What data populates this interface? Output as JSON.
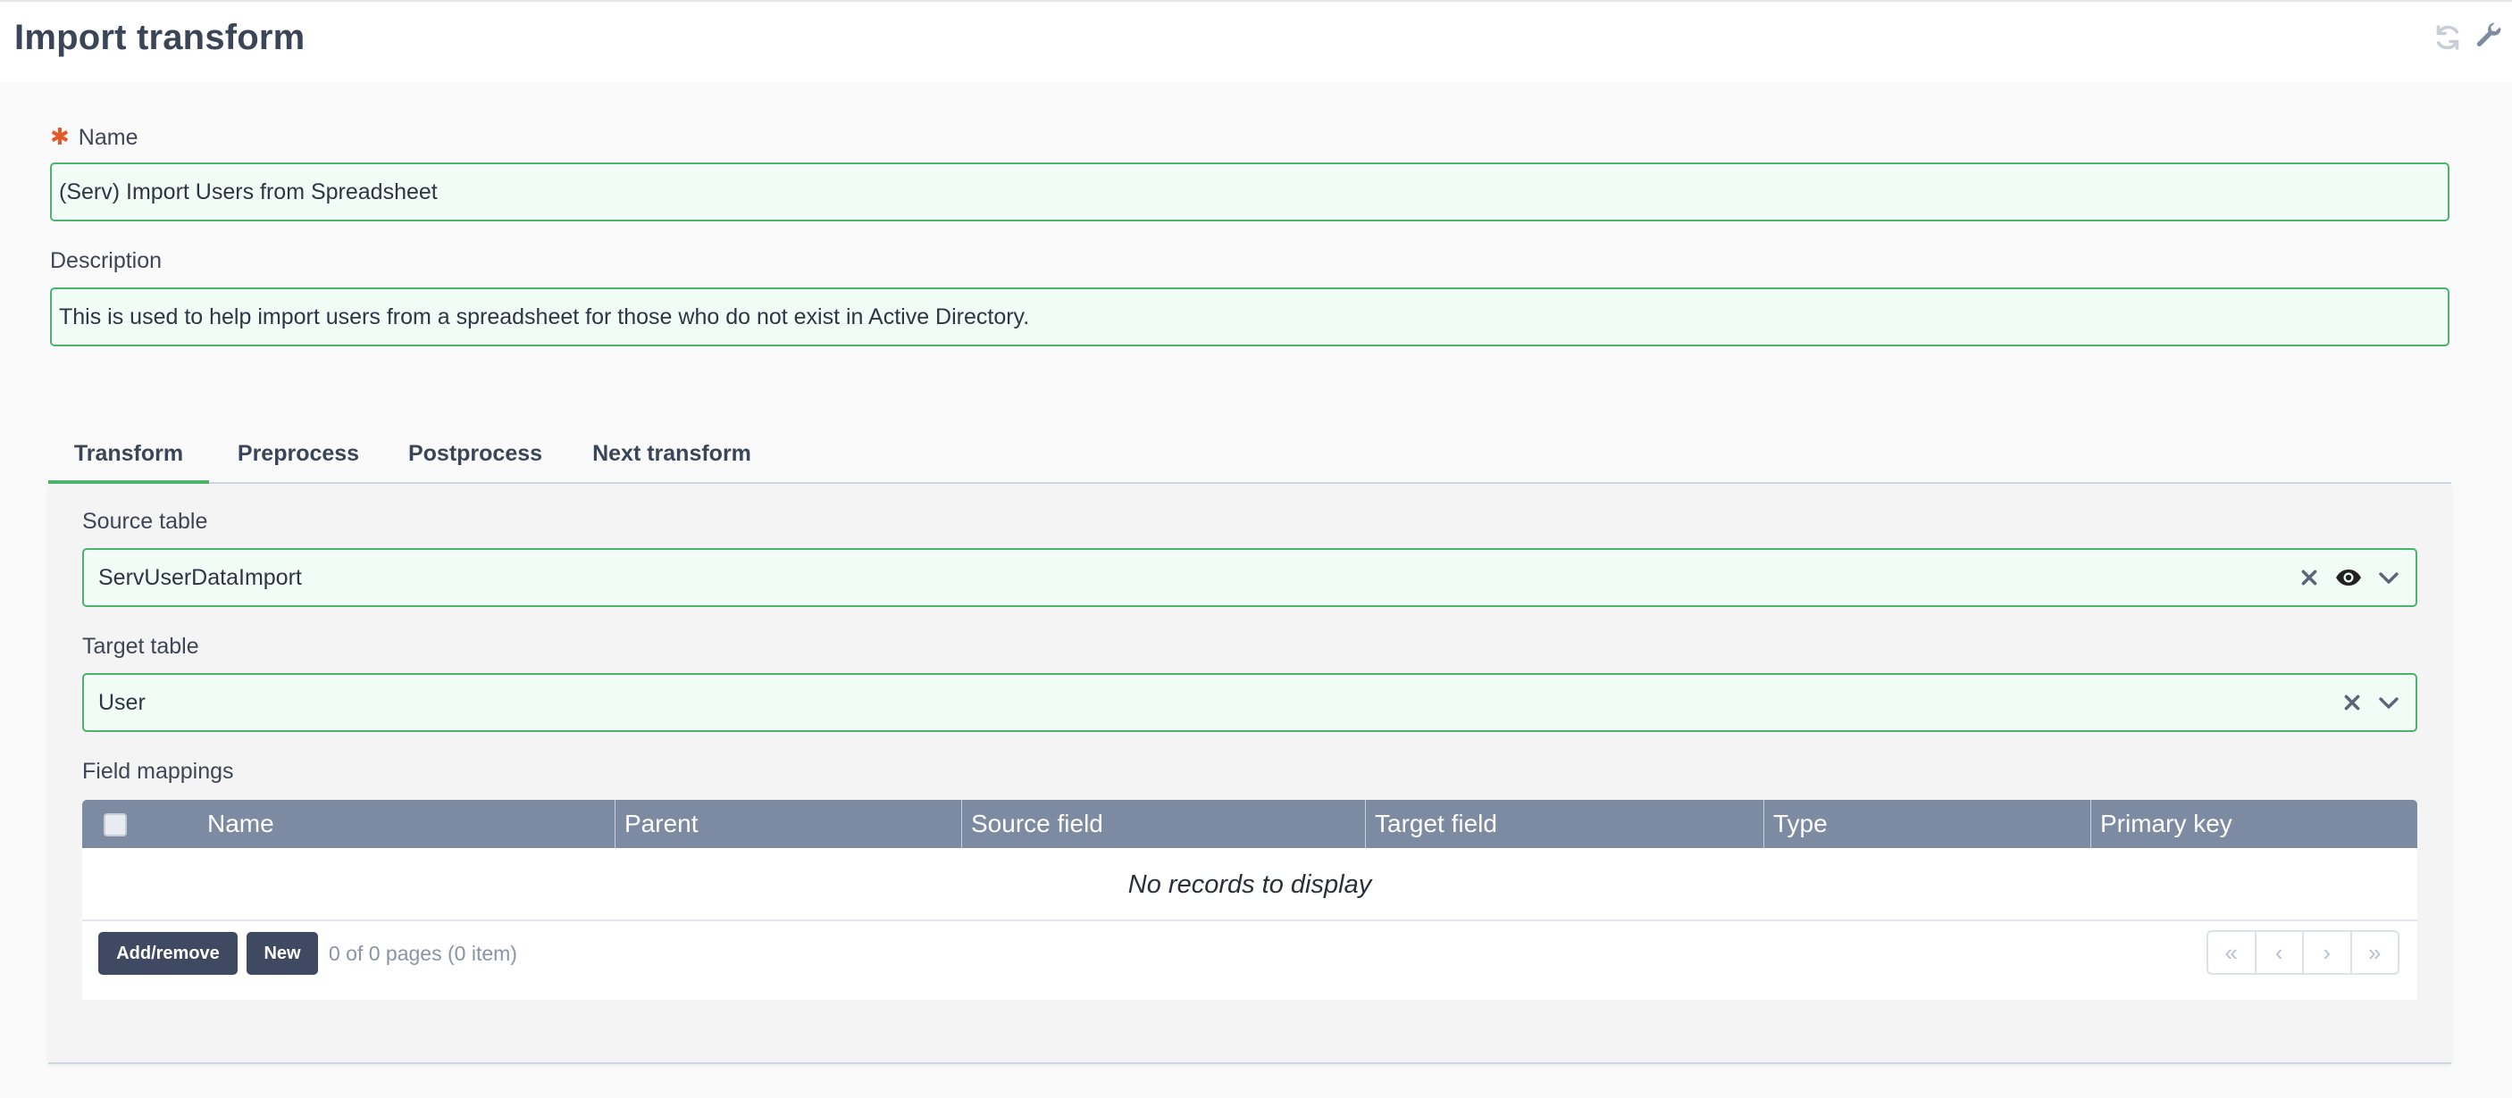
{
  "header": {
    "title": "Import transform",
    "icons": [
      "refresh-icon",
      "wrench-icon"
    ]
  },
  "form": {
    "name_label": "Name",
    "name_required_mark": "✱",
    "name_value": "(Serv) Import Users from Spreadsheet",
    "description_label": "Description",
    "description_value": "This is used to help import users from a spreadsheet for those who do not exist in Active Directory."
  },
  "tabs": [
    {
      "label": "Transform",
      "active": true
    },
    {
      "label": "Preprocess",
      "active": false
    },
    {
      "label": "Postprocess",
      "active": false
    },
    {
      "label": "Next transform",
      "active": false
    }
  ],
  "transform": {
    "source_label": "Source table",
    "source_value": "ServUserDataImport",
    "source_icons": [
      "clear-icon",
      "eye-icon",
      "chevron-down-icon"
    ],
    "target_label": "Target table",
    "target_value": "User",
    "target_icons": [
      "clear-icon",
      "chevron-down-icon"
    ],
    "mappings_label": "Field mappings"
  },
  "grid": {
    "columns": [
      "Name",
      "Parent",
      "Source field",
      "Target field",
      "Type",
      "Primary key"
    ],
    "empty_text": "No records to display",
    "add_remove_label": "Add/remove",
    "new_label": "New",
    "page_info": "0 of 0 pages (0 item)",
    "pager": [
      "«",
      "‹",
      "›",
      "»"
    ]
  },
  "colors": {
    "accent_green": "#4cb36e",
    "input_bg": "#f1fcf7",
    "grid_header": "#7c8aa2",
    "button_dark": "#3f4a62",
    "required_star": "#e5582a"
  }
}
